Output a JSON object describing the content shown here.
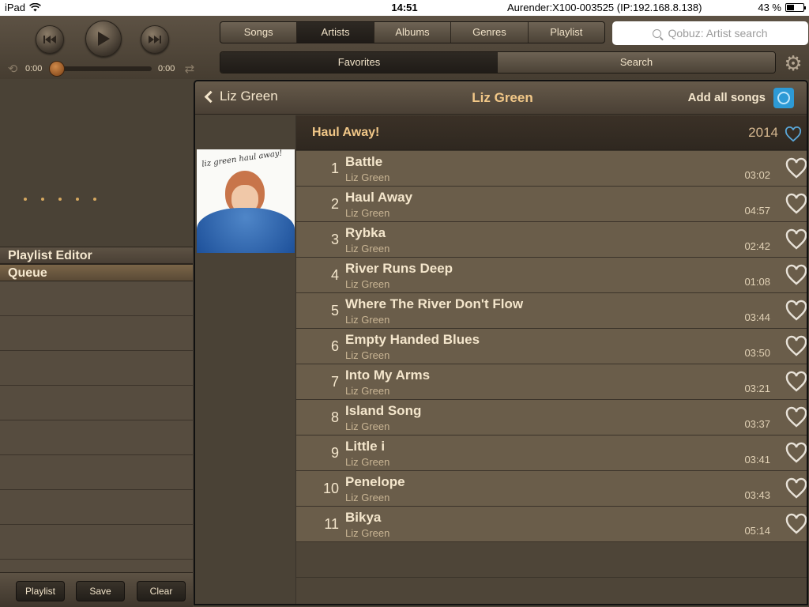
{
  "status": {
    "device": "iPad",
    "time": "14:51",
    "server": "Aurender:X100-003525 (IP:192.168.8.138)",
    "battery": "43 %",
    "battery_level": 0.43
  },
  "player": {
    "elapsed": "0:00",
    "remaining": "0:00",
    "progress": 0
  },
  "tabs": [
    "Songs",
    "Artists",
    "Albums",
    "Genres",
    "Playlist"
  ],
  "active_tab": "Artists",
  "search": {
    "placeholder": "Qobuz: Artist search"
  },
  "subtabs": [
    "Favorites",
    "Search"
  ],
  "active_subtab": "Favorites",
  "sidebar": {
    "playlist_editor": "Playlist Editor",
    "queue": "Queue",
    "buttons": {
      "playlist": "Playlist",
      "save": "Save",
      "clear": "Clear"
    }
  },
  "main": {
    "back_label": "Liz Green",
    "title": "Liz Green",
    "add_all": "Add all songs",
    "album": {
      "title": "Haul Away!",
      "year": "2014",
      "cover_text": "liz green haul away!"
    },
    "tracks": [
      {
        "num": "1",
        "title": "Battle",
        "artist": "Liz Green",
        "duration": "03:02"
      },
      {
        "num": "2",
        "title": "Haul Away",
        "artist": "Liz Green",
        "duration": "04:57"
      },
      {
        "num": "3",
        "title": "Rybka",
        "artist": "Liz Green",
        "duration": "02:42"
      },
      {
        "num": "4",
        "title": "River Runs Deep",
        "artist": "Liz Green",
        "duration": "01:08"
      },
      {
        "num": "5",
        "title": "Where The River Don't Flow",
        "artist": "Liz Green",
        "duration": "03:44"
      },
      {
        "num": "6",
        "title": "Empty Handed Blues",
        "artist": "Liz Green",
        "duration": "03:50"
      },
      {
        "num": "7",
        "title": "Into My Arms",
        "artist": "Liz Green",
        "duration": "03:21"
      },
      {
        "num": "8",
        "title": "Island Song",
        "artist": "Liz Green",
        "duration": "03:37"
      },
      {
        "num": "9",
        "title": "Little i",
        "artist": "Liz Green",
        "duration": "03:41"
      },
      {
        "num": "10",
        "title": "Penelope",
        "artist": "Liz Green",
        "duration": "03:43"
      },
      {
        "num": "11",
        "title": "Bikya",
        "artist": "Liz Green",
        "duration": "05:14"
      }
    ]
  },
  "colors": {
    "accent_title": "#f2c888",
    "add_icon": "#2d9ad6",
    "progress_knob": "#c07a3a"
  },
  "icons": {
    "previous": "previous-icon",
    "play": "play-icon",
    "next": "next-icon",
    "repeat": "repeat-icon",
    "shuffle": "shuffle-icon",
    "settings": "gear-icon",
    "favorite": "heart-icon",
    "add_all": "circle-add-icon"
  }
}
